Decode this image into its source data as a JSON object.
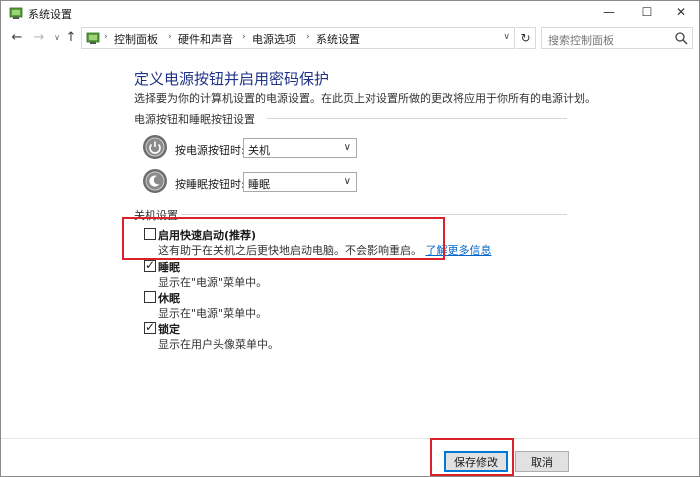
{
  "window": {
    "title": "系统设置",
    "controls": {
      "minimize": "—",
      "maximize": "☐",
      "close": "✕"
    }
  },
  "nav": {
    "back": "←",
    "forward": "→",
    "dropdown": "∨",
    "up": "↑",
    "breadcrumbs": [
      "控制面板",
      "硬件和声音",
      "电源选项",
      "系统设置"
    ],
    "separator": "›",
    "address_dropdown": "∨",
    "refresh": "↻",
    "search_placeholder": "搜索控制面板"
  },
  "main": {
    "title": "定义电源按钮并启用密码保护",
    "description": "选择要为你的计算机设置的电源设置。在此页上对设置所做的更改将应用于你所有的电源计划。",
    "power_section": {
      "heading": "电源按钮和睡眠按钮设置",
      "power_button": {
        "label": "按电源按钮时:",
        "value": "关机"
      },
      "sleep_button": {
        "label": "按睡眠按钮时:",
        "value": "睡眠"
      }
    },
    "shutdown_section": {
      "heading": "关机设置",
      "options": [
        {
          "label": "启用快速启动(推荐)",
          "desc": "这有助于在关机之后更快地启动电脑。不会影响重启。",
          "link": "了解更多信息",
          "checked": false
        },
        {
          "label": "睡眠",
          "desc": "显示在\"电源\"菜单中。",
          "checked": true
        },
        {
          "label": "休眠",
          "desc": "显示在\"电源\"菜单中。",
          "checked": false
        },
        {
          "label": "锁定",
          "desc": "显示在用户头像菜单中。",
          "checked": true
        }
      ]
    }
  },
  "footer": {
    "save_label": "保存修改",
    "cancel_label": "取消"
  },
  "colors": {
    "title_blue": "#1e3287",
    "link_blue": "#0066cc",
    "highlight_red": "#d8232a",
    "button_focus": "#0078d7"
  }
}
